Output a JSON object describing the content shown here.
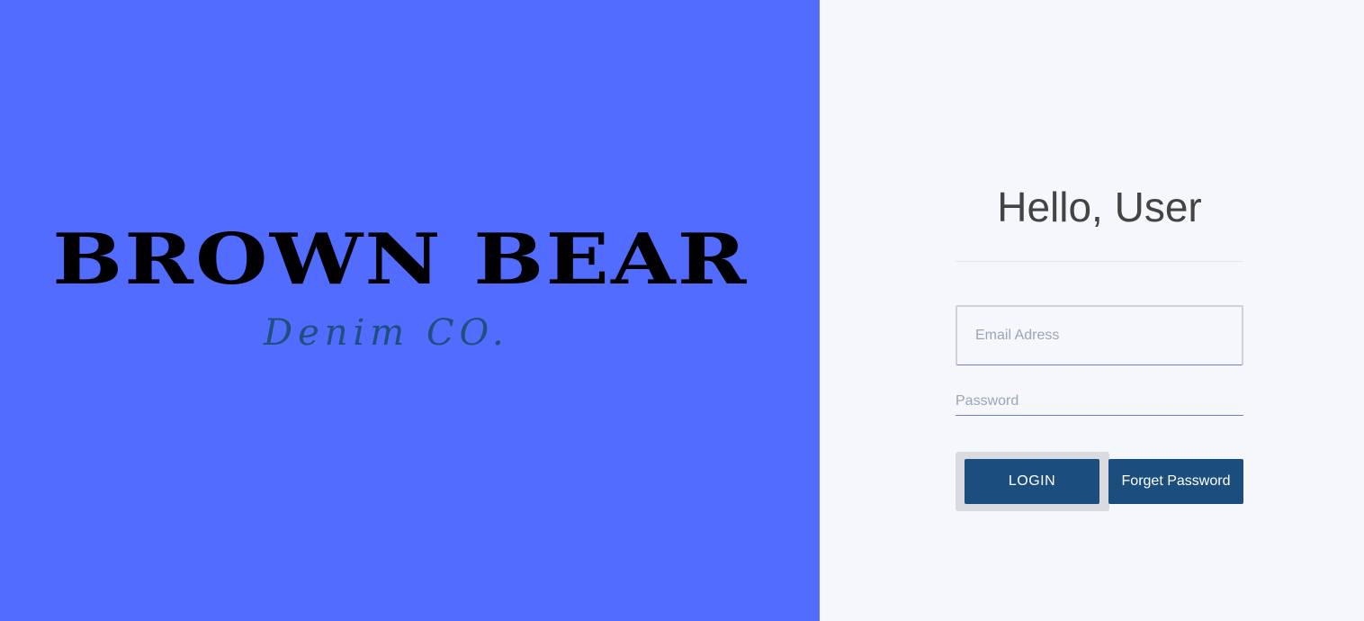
{
  "brand": {
    "name": "BROWN BEAR",
    "tagline": "Denim CO."
  },
  "login": {
    "greeting": "Hello, User",
    "email_placeholder": "Email Adress",
    "password_placeholder": "Password",
    "login_label": "LOGIN",
    "forgot_label": "Forget Password"
  },
  "colors": {
    "left_panel": "#526cff",
    "right_panel": "#f5f7fc",
    "button": "#1c4e7d",
    "tagline": "#1f4f7d"
  }
}
